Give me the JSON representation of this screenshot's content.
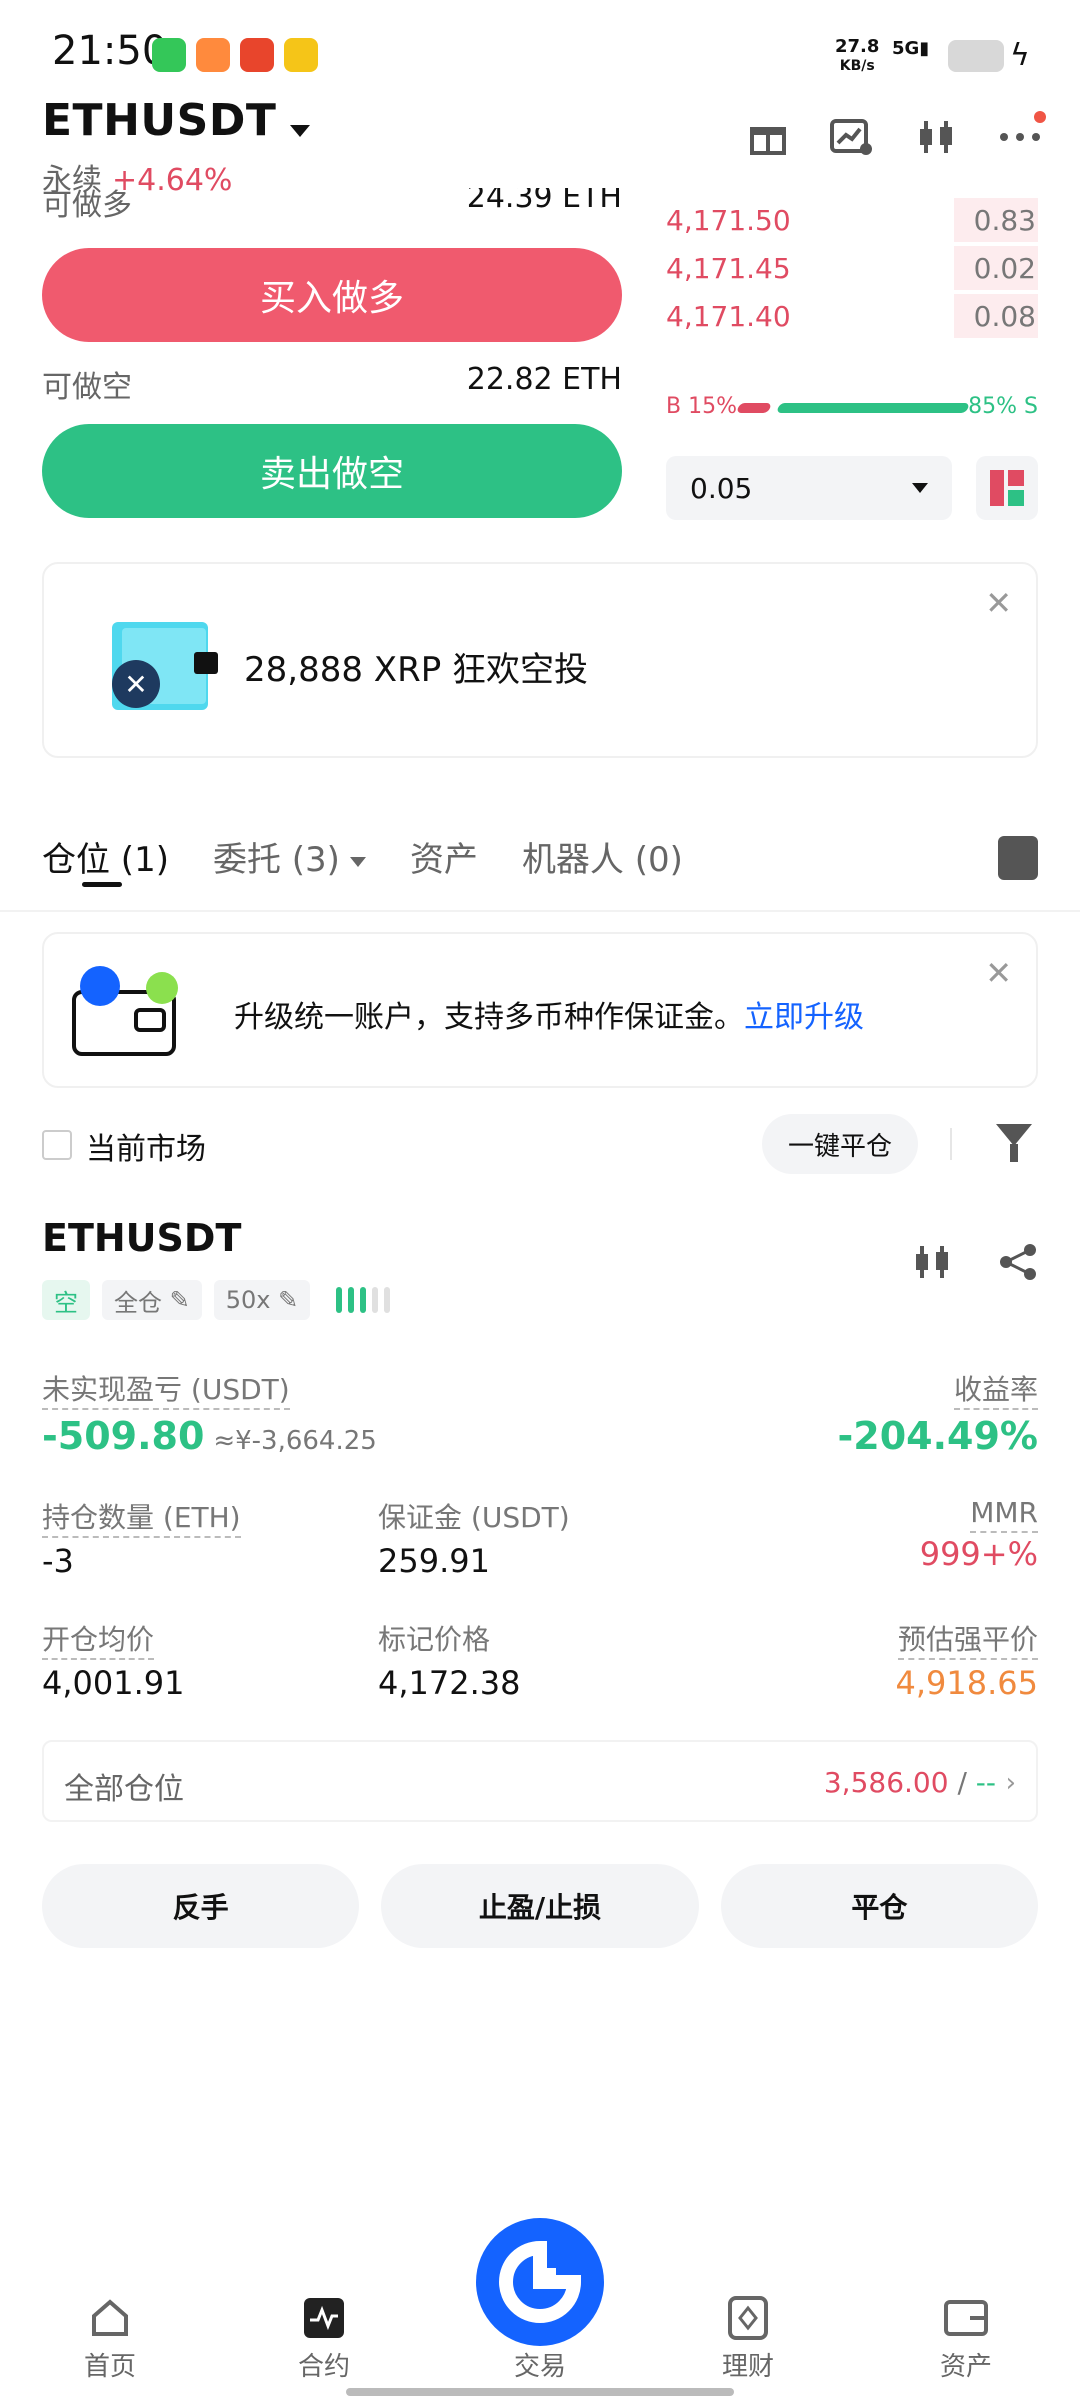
{
  "status": {
    "time": "21:50",
    "net_speed": "27.8",
    "net_unit": "KB/s",
    "network": "5G"
  },
  "header": {
    "symbol": "ETHUSDT",
    "type": "永续",
    "change": "+4.64%"
  },
  "trade": {
    "long_avail_label": "可做多",
    "long_avail_value": "24.39 ETH",
    "buy_label": "买入做多",
    "short_avail_label": "可做空",
    "short_avail_value": "22.82 ETH",
    "sell_label": "卖出做空"
  },
  "orderbook": {
    "rows": [
      {
        "price": "4,171.50",
        "qty": "0.83"
      },
      {
        "price": "4,171.45",
        "qty": "0.02"
      },
      {
        "price": "4,171.40",
        "qty": "0.08"
      }
    ],
    "buy_ratio": "B 15%",
    "sell_ratio": "85% S",
    "precision": "0.05"
  },
  "promo": {
    "text": "28,888 XRP 狂欢空投"
  },
  "tabs": {
    "positions": "仓位 (1)",
    "orders": "委托 (3)",
    "assets": "资产",
    "bots": "机器人 (0)"
  },
  "upgrade": {
    "text": "升级统一账户，支持多币种作保证金。",
    "link": "立即升级"
  },
  "filter": {
    "current_market": "当前市场",
    "close_all": "一键平仓"
  },
  "position": {
    "symbol": "ETHUSDT",
    "side": "空",
    "margin_mode": "全仓",
    "leverage": "50x",
    "pnl_label": "未实现盈亏 (USDT)",
    "pnl_value": "-509.80",
    "pnl_cny": "≈¥-3,664.25",
    "roe_label": "收益率",
    "roe_value": "-204.49%",
    "size_label": "持仓数量 (ETH)",
    "size_value": "-3",
    "margin_label": "保证金 (USDT)",
    "margin_value": "259.91",
    "mmr_label": "MMR",
    "mmr_value": "999+%",
    "entry_label": "开仓均价",
    "entry_value": "4,001.91",
    "mark_label": "标记价格",
    "mark_value": "4,172.38",
    "liq_label": "预估强平价",
    "liq_value": "4,918.65"
  },
  "all_positions": {
    "label": "全部仓位",
    "value": "3,586.00",
    "sep": " / ",
    "value2": "--"
  },
  "actions": {
    "reverse": "反手",
    "tpsl": "止盈/止损",
    "close": "平仓"
  },
  "nav": {
    "home": "首页",
    "futures": "合约",
    "trade": "交易",
    "earn": "理财",
    "assets": "资产"
  }
}
